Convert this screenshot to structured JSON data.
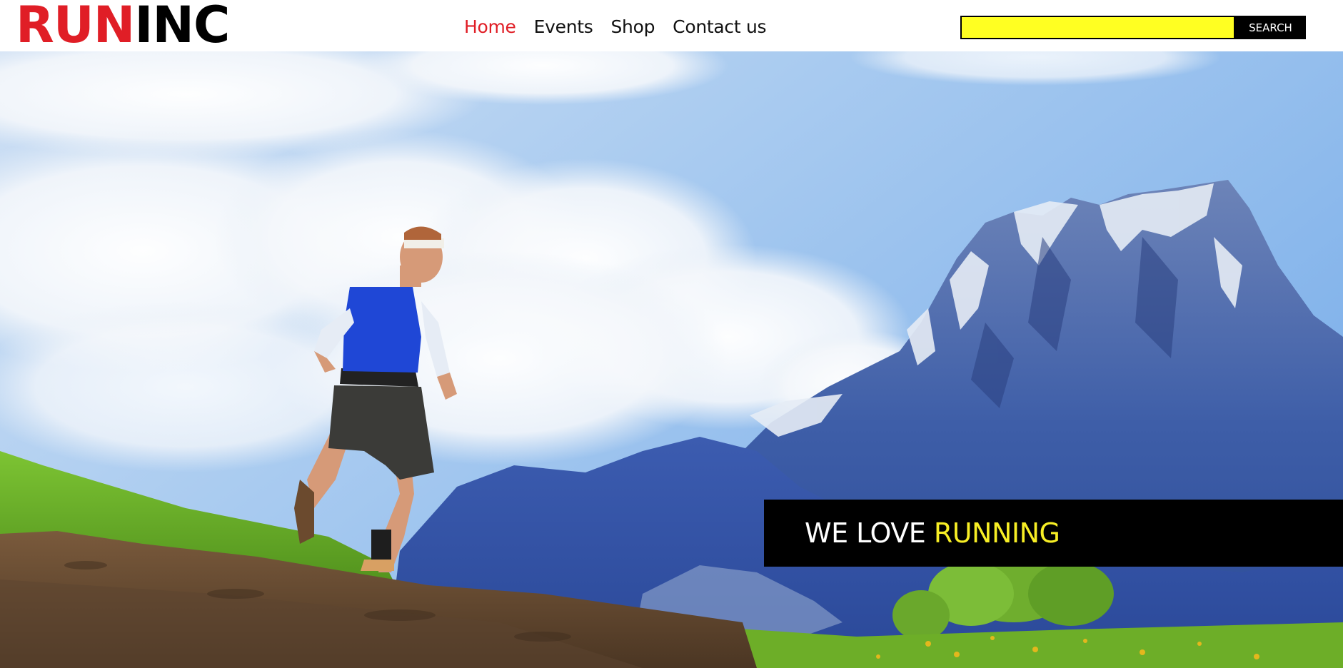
{
  "header": {
    "logo": {
      "part_a": "RUN",
      "part_b": "INC"
    },
    "nav": [
      {
        "label": "Home",
        "active": true
      },
      {
        "label": "Events",
        "active": false
      },
      {
        "label": "Shop",
        "active": false
      },
      {
        "label": "Contact us",
        "active": false
      }
    ],
    "search": {
      "value": "",
      "placeholder": "",
      "button_label": "SEARCH"
    }
  },
  "hero": {
    "image_description_icon": "runner-mountain-photo",
    "banner": {
      "text_white": "WE LOVE",
      "text_highlight": "RUNNING"
    }
  },
  "colors": {
    "accent_red": "#e01e26",
    "search_yellow": "#ffff22",
    "highlight_yellow": "#f7ee25",
    "banner_black": "#000000"
  }
}
